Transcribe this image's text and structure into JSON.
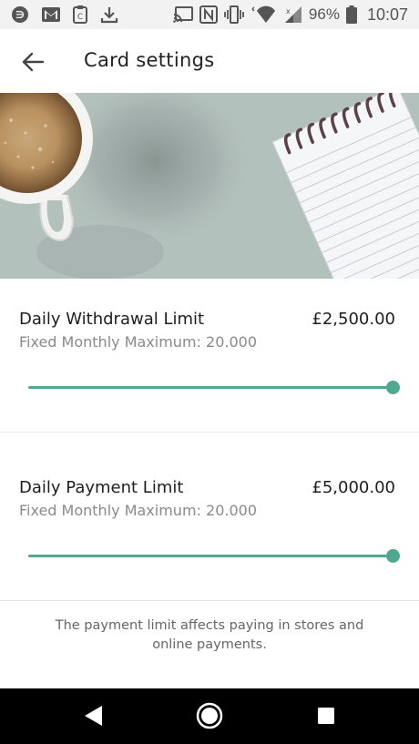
{
  "status_bar": {
    "battery": "96%",
    "time": "10:07",
    "icons_left": [
      "app-notification-icon",
      "gmail-icon",
      "clipboard-icon",
      "download-icon"
    ],
    "icons_right": [
      "cast-icon",
      "nfc-icon",
      "vibrate-icon",
      "wifi-icon",
      "signal-icon",
      "battery-icon"
    ]
  },
  "header": {
    "back_icon": "arrow-left-icon",
    "title": "Card settings"
  },
  "hero_image": "coffee-and-notepad-banner",
  "limits": [
    {
      "title": "Daily Withdrawal Limit",
      "amount": "£2,500.00",
      "subtitle": "Fixed Monthly Maximum: 20.000",
      "slider_fraction": 1.0
    },
    {
      "title": "Daily Payment Limit",
      "amount": "£5,000.00",
      "subtitle": "Fixed Monthly Maximum: 20.000",
      "slider_fraction": 1.0
    }
  ],
  "note": "The payment limit affects paying in stores and online payments.",
  "nav_bar": {
    "icons": [
      "back-triangle-icon",
      "home-circle-icon",
      "recents-square-icon"
    ]
  },
  "colors": {
    "accent": "#4fa88f",
    "hero_background": "#b3c1bd"
  }
}
